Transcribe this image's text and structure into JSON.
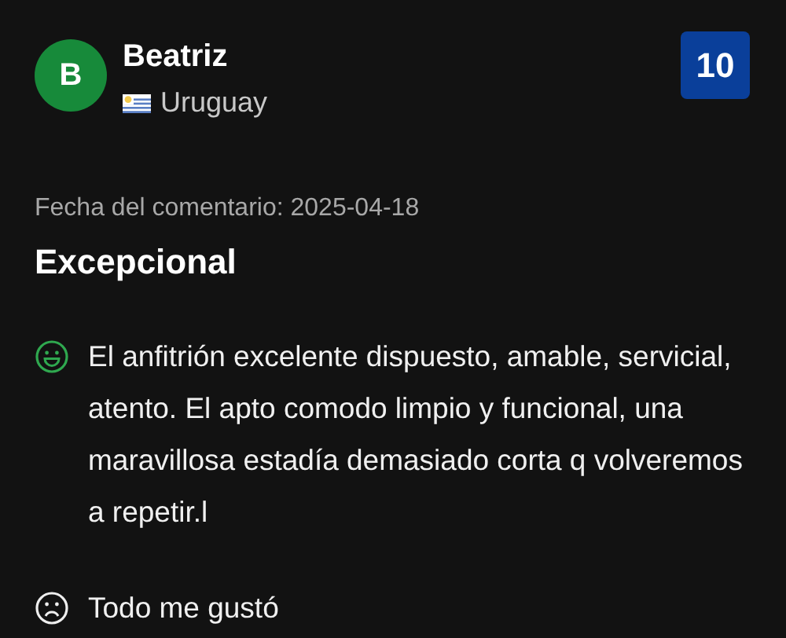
{
  "reviewer": {
    "initial": "B",
    "name": "Beatriz",
    "country": "Uruguay"
  },
  "score": "10",
  "date": "Fecha del comentario: 2025-04-18",
  "title": "Excepcional",
  "comments": [
    {
      "kind": "positive",
      "text": "El anfitrión excelente dispuesto, amable, servicial, atento. El apto comodo limpio y funcional, una maravillosa estadía demasiado corta q volveremos a repetir.l"
    },
    {
      "kind": "negative",
      "text": "Todo me gustó"
    }
  ]
}
